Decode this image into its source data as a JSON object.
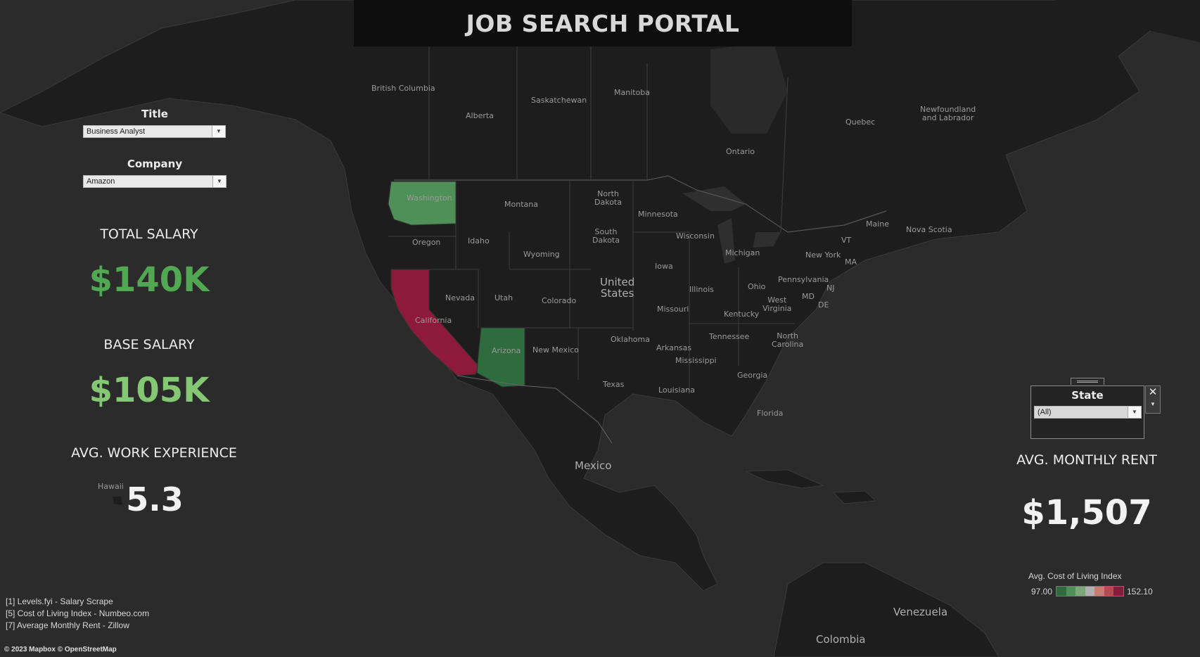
{
  "dashboard_title": "JOB SEARCH PORTAL",
  "filters": {
    "title": {
      "label": "Title",
      "value": "Business Analyst"
    },
    "company": {
      "label": "Company",
      "value": "Amazon"
    },
    "state": {
      "label": "State",
      "value": "(All)"
    }
  },
  "kpis": {
    "total_salary": {
      "label": "TOTAL SALARY",
      "value": "$140K",
      "color": "#52a852"
    },
    "base_salary": {
      "label": "BASE SALARY",
      "value": "$105K",
      "color": "#84c874"
    },
    "avg_work_experience": {
      "label": "AVG. WORK EXPERIENCE",
      "value": "5.3"
    },
    "avg_monthly_rent": {
      "label": "AVG. MONTHLY RENT",
      "value": "$1,507"
    }
  },
  "legend": {
    "title": "Avg. Cost of Living Index",
    "min": "97.00",
    "max": "152.10",
    "colors": [
      "#2e6b3d",
      "#4f8f58",
      "#7aa877",
      "#b0b0b0",
      "#c97a72",
      "#b54b52",
      "#8e1a3b"
    ]
  },
  "highlighted_states": [
    {
      "name": "Washington",
      "color": "#4f8f58"
    },
    {
      "name": "California",
      "color": "#8e1a3b"
    },
    {
      "name": "Arizona",
      "color": "#2e6b3d"
    }
  ],
  "map_labels": {
    "british_columbia": "British\nColumbia",
    "alberta": "Alberta",
    "saskatchewan": "Saskatchewan",
    "manitoba": "Manitoba",
    "ontario": "Ontario",
    "quebec": "Quebec",
    "newfoundland": "Newfoundland\nand Labrador",
    "washington": "Washington",
    "oregon": "Oregon",
    "california": "California",
    "nevada": "Nevada",
    "idaho": "Idaho",
    "montana": "Montana",
    "wyoming": "Wyoming",
    "utah": "Utah",
    "arizona": "Arizona",
    "colorado": "Colorado",
    "new_mexico": "New Mexico",
    "north_dakota": "North\nDakota",
    "south_dakota": "South\nDakota",
    "minnesota": "Minnesota",
    "iowa": "Iowa",
    "wisconsin": "Wisconsin",
    "michigan": "Michigan",
    "illinois": "Illinois",
    "missouri": "Missouri",
    "oklahoma": "Oklahoma",
    "texas": "Texas",
    "arkansas": "Arkansas",
    "mississippi": "Mississippi",
    "louisiana": "Louisiana",
    "tennessee": "Tennessee",
    "kentucky": "Kentucky",
    "ohio": "Ohio",
    "west_virginia": "West\nVirginia",
    "pennsylvania": "Pennsylvania",
    "new_york": "New York",
    "north_carolina": "North\nCarolina",
    "georgia": "Georgia",
    "florida": "Florida",
    "maine": "Maine",
    "vt": "VT",
    "ma": "MA",
    "nj": "NJ",
    "md": "MD",
    "de": "DE",
    "nova_scotia": "Nova Scotia",
    "united_states": "United\nStates",
    "mexico": "Mexico",
    "venezuela": "Venezuela",
    "colombia": "Colombia",
    "hawaii": "Hawaii"
  },
  "sources": [
    "[1] Levels.fyi - Salary Scrape",
    "[5] Cost of Living Index - Numbeo.com",
    "[7] Average Monthly Rent - Zillow"
  ],
  "attribution": "© 2023 Mapbox © OpenStreetMap"
}
